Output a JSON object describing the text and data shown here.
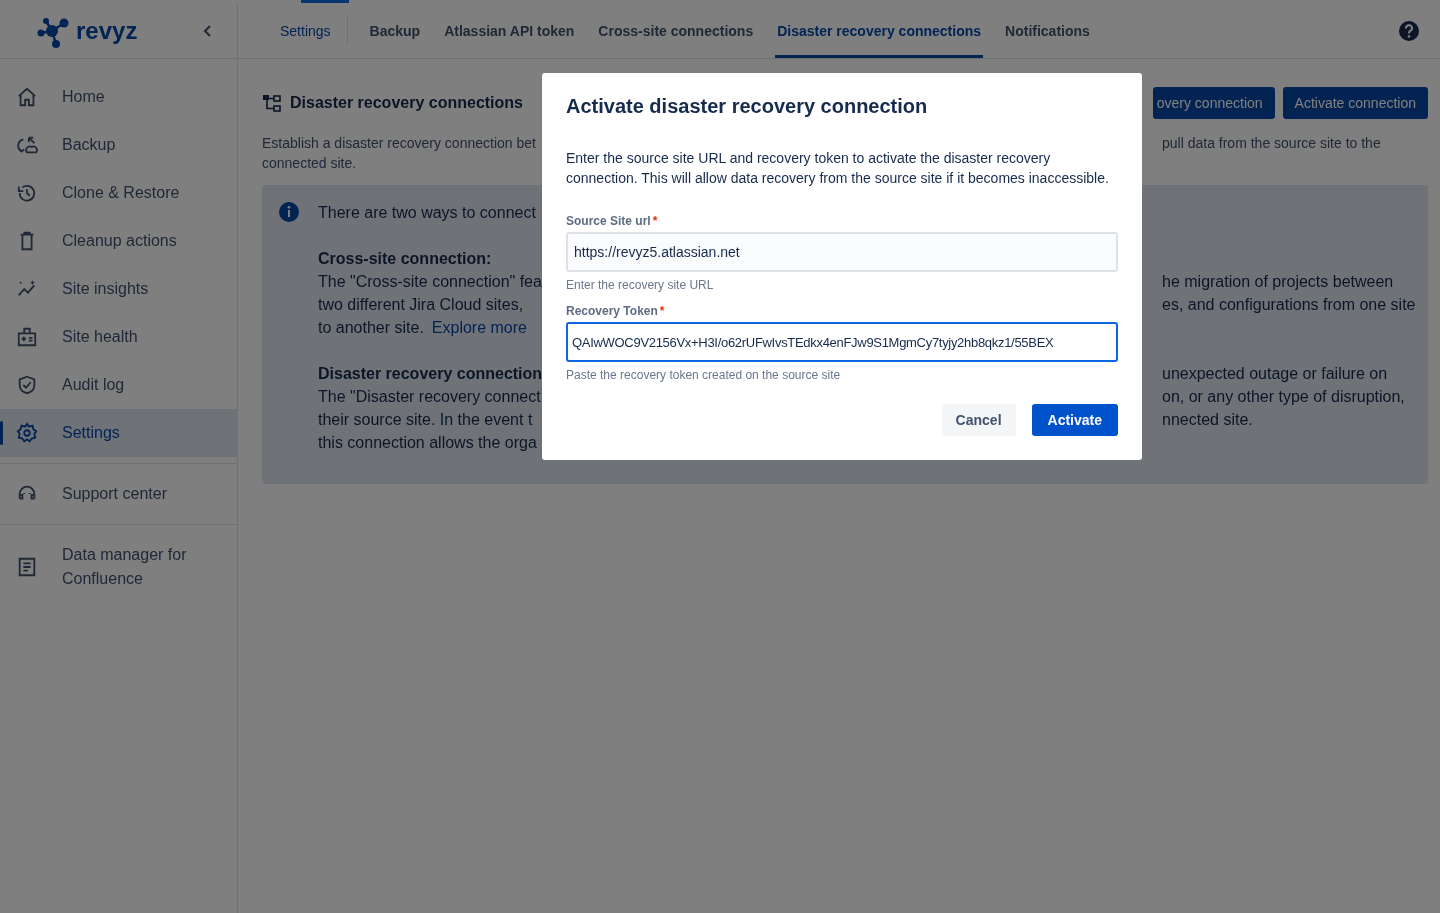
{
  "sidebar": {
    "logo": "revyz",
    "groups": [
      {
        "items": [
          {
            "label": "Home",
            "selected": false
          },
          {
            "label": "Backup",
            "selected": false
          },
          {
            "label": "Clone & Restore",
            "selected": false
          },
          {
            "label": "Cleanup actions",
            "selected": false
          },
          {
            "label": "Site insights",
            "selected": false
          },
          {
            "label": "Site health",
            "selected": false
          },
          {
            "label": "Audit log",
            "selected": false
          },
          {
            "label": "Settings",
            "selected": true
          }
        ]
      },
      {
        "items": [
          {
            "label": "Support center",
            "selected": false
          }
        ]
      },
      {
        "items": [
          {
            "label": "Data manager for Confluence",
            "selected": false
          }
        ]
      }
    ]
  },
  "tabs": [
    {
      "label": "Settings",
      "selected": false,
      "kind": "link"
    },
    {
      "label": "Backup",
      "selected": false,
      "kind": "tab"
    },
    {
      "label": "Atlassian API token",
      "selected": false,
      "kind": "tab"
    },
    {
      "label": "Cross-site connections",
      "selected": false,
      "kind": "tab"
    },
    {
      "label": "Disaster recovery connections",
      "selected": true,
      "kind": "tab"
    },
    {
      "label": "Notifications",
      "selected": false,
      "kind": "tab"
    }
  ],
  "page": {
    "title": "Disaster recovery connections",
    "buttons": [
      "overy connection",
      "Activate connection"
    ],
    "description_left": [
      "Establish a disaster recovery connection bet",
      "connected site."
    ],
    "description_right": [
      "pull data from the source site to the"
    ],
    "info": {
      "left": [
        {
          "kind": "text",
          "text": "There are two ways to connect"
        },
        {
          "kind": "heading",
          "text": "Cross-site connection:"
        },
        {
          "kind": "text",
          "text": "The \"Cross-site connection\" fea"
        },
        {
          "kind": "text",
          "text": "two different Jira Cloud sites,"
        },
        {
          "kind": "link-line",
          "text": "to another site.",
          "link": "Explore more"
        },
        {
          "kind": "heading",
          "text": "Disaster recovery connection"
        },
        {
          "kind": "text",
          "text": "The \"Disaster recovery connect"
        },
        {
          "kind": "text",
          "text": "their source site. In the event t"
        },
        {
          "kind": "text",
          "text": "this connection allows the orga"
        }
      ],
      "right": [
        {
          "kind": "blank"
        },
        {
          "kind": "blank"
        },
        {
          "kind": "text",
          "text": "he migration of projects between"
        },
        {
          "kind": "text",
          "text": "es, and configurations from one site"
        },
        {
          "kind": "blank"
        },
        {
          "kind": "blank"
        },
        {
          "kind": "text",
          "text": "unexpected outage or failure on"
        },
        {
          "kind": "text",
          "text": "on, or any other type of disruption,"
        },
        {
          "kind": "text",
          "text": "nnected site."
        }
      ]
    }
  },
  "dialog": {
    "title": "Activate disaster recovery connection",
    "description": "Enter the source site URL and recovery token to activate the disaster recovery connection. This will allow data recovery from the source site if it becomes inaccessible.",
    "fields": [
      {
        "label": "Source Site url",
        "required_mark": "*",
        "value": "https://revyz5.atlassian.net",
        "helper": "Enter the recovery site URL",
        "focused": false
      },
      {
        "label": "Recovery Token",
        "required_mark": "*",
        "value": "QAIwWOC9V2156Vx+H3I/o62rUFwIvsTEdkx4enFJw9S1MgmCy7tyjy2hb8qkz1/55BEX",
        "helper": "Paste the recovery token created on the source site",
        "focused": true
      }
    ],
    "buttons": [
      {
        "label": "Cancel",
        "kind": "subtle"
      },
      {
        "label": "Activate",
        "kind": "primary"
      }
    ]
  }
}
